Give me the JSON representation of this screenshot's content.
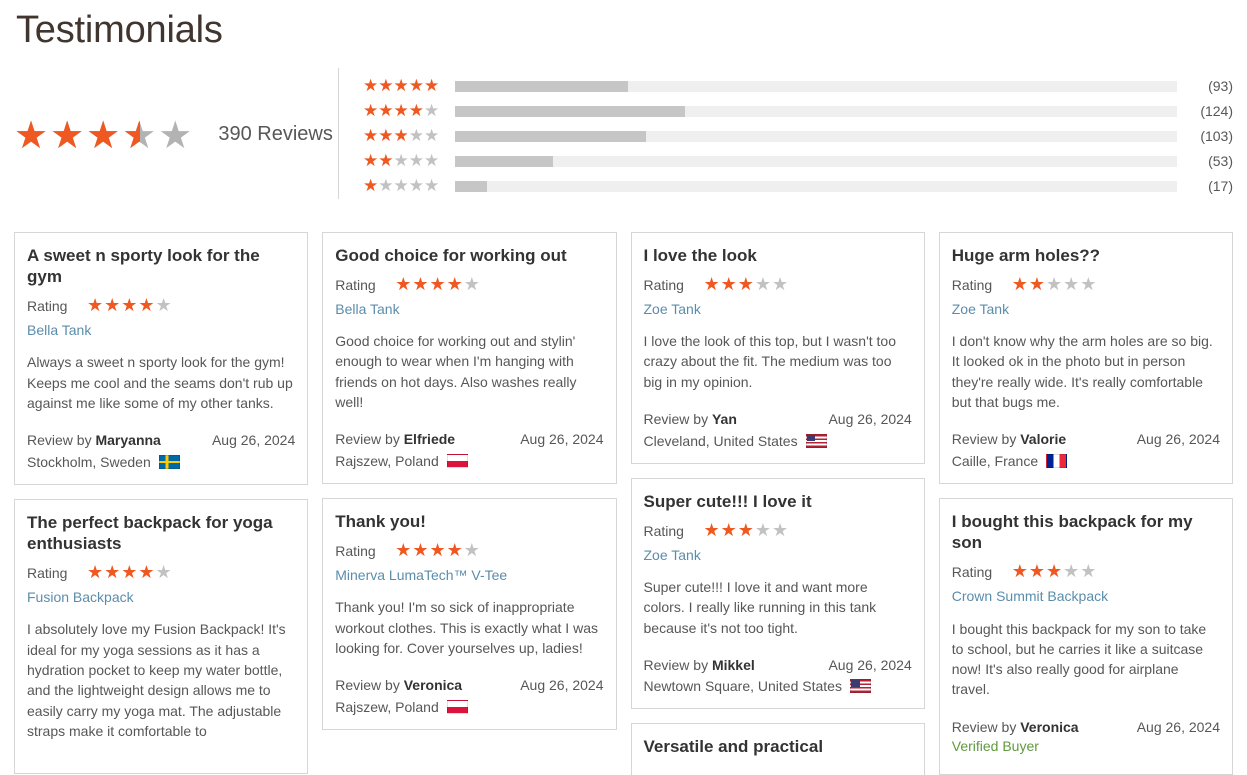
{
  "page": {
    "title": "Testimonials"
  },
  "summary": {
    "average_rating": 3.5,
    "average_stars_pct": 70,
    "reviews_count_label": "390 Reviews",
    "histogram": [
      {
        "stars": 5,
        "count_label": "(93)",
        "count": 93,
        "bar_pct": 24.0
      },
      {
        "stars": 4,
        "count_label": "(124)",
        "count": 124,
        "bar_pct": 31.8
      },
      {
        "stars": 3,
        "count_label": "(103)",
        "count": 103,
        "bar_pct": 26.5
      },
      {
        "stars": 2,
        "count_label": "(53)",
        "count": 53,
        "bar_pct": 13.6
      },
      {
        "stars": 1,
        "count_label": "(17)",
        "count": 17,
        "bar_pct": 4.4
      }
    ]
  },
  "labels": {
    "rating": "Rating",
    "review_by_prefix": "Review by",
    "verified_buyer": "Verified Buyer"
  },
  "colors": {
    "star_on": "#f05822",
    "star_off": "#c2c2c2",
    "link": "#5b8dab",
    "verified": "#5f9a3e",
    "bar_fill": "#c6c6c6",
    "bar_track": "#efefef"
  },
  "columns": [
    {
      "cards": [
        {
          "title": "A sweet n sporty look for the gym",
          "rating": 4,
          "product": "Bella Tank",
          "body": "Always a sweet n sporty look for the gym! Keeps me cool and the seams don't rub up against me like some of my other tanks.",
          "author": "Maryanna",
          "verified": false,
          "date": "Aug 26, 2024",
          "location": "Stockholm, Sweden",
          "flag": "flag-se",
          "flag_name": "sweden-flag-icon"
        },
        {
          "title": "The perfect backpack for yoga enthusiasts",
          "rating": 4,
          "product": "Fusion Backpack",
          "body": "I absolutely love my Fusion Backpack! It's ideal for my yoga sessions as it has a hydration pocket to keep my water bottle, and the lightweight design allows me to easily carry my yoga mat. The adjustable straps make it comfortable to",
          "author": "",
          "verified": false,
          "date": "",
          "location": "",
          "flag": "",
          "flag_name": "",
          "clipped": true
        }
      ]
    },
    {
      "cards": [
        {
          "title": "Good choice for working out",
          "rating": 4,
          "product": "Bella Tank",
          "body": "Good choice for working out and stylin' enough to wear when I'm hanging with friends on hot days. Also washes really well!",
          "author": "Elfriede",
          "verified": false,
          "date": "Aug 26, 2024",
          "location": "Rajszew, Poland",
          "flag": "flag-pl",
          "flag_name": "poland-flag-icon"
        },
        {
          "title": "Thank you!",
          "rating": 4,
          "product": "Minerva LumaTech™ V-Tee",
          "body": "Thank you! I'm so sick of inappropriate workout clothes. This is exactly what I was looking for. Cover yourselves up, ladies!",
          "author": "Veronica",
          "verified": false,
          "date": "Aug 26, 2024",
          "location": "Rajszew, Poland",
          "flag": "flag-pl",
          "flag_name": "poland-flag-icon"
        }
      ]
    },
    {
      "cards": [
        {
          "title": "I love the look",
          "rating": 3,
          "product": "Zoe Tank",
          "body": "I love the look of this top, but I wasn't too crazy about the fit. The medium was too big in my opinion.",
          "author": "Yan",
          "verified": false,
          "date": "Aug 26, 2024",
          "location": "Cleveland, United States",
          "flag": "flag-us",
          "flag_name": "united-states-flag-icon"
        },
        {
          "title": "Super cute!!! I love it",
          "rating": 3,
          "product": "Zoe Tank",
          "body": "Super cute!!! I love it and want more colors. I really like running in this tank because it's not too tight.",
          "author": "Mikkel",
          "verified": false,
          "date": "Aug 26, 2024",
          "location": "Newtown Square, United States",
          "flag": "flag-us",
          "flag_name": "united-states-flag-icon"
        },
        {
          "title": "Versatile and practical",
          "rating": 0,
          "product": "",
          "body": "",
          "author": "",
          "verified": false,
          "date": "",
          "location": "",
          "flag": "",
          "flag_name": "",
          "clipped": true
        }
      ]
    },
    {
      "cards": [
        {
          "title": "Huge arm holes??",
          "rating": 2,
          "product": "Zoe Tank",
          "body": "I don't know why the arm holes are so big. It looked ok in the photo but in person they're really wide. It's really comfortable but that bugs me.",
          "author": "Valorie",
          "verified": false,
          "date": "Aug 26, 2024",
          "location": "Caille, France",
          "flag": "flag-fr",
          "flag_name": "france-flag-icon"
        },
        {
          "title": "I bought this backpack for my son",
          "rating": 3,
          "product": "Crown Summit Backpack",
          "body": "I bought this backpack for my son to take to school, but he carries it like a suitcase now! It's also really good for airplane travel.",
          "author": "Veronica",
          "verified": true,
          "date": "Aug 26, 2024",
          "location": "",
          "flag": "",
          "flag_name": "",
          "clipped": true
        }
      ]
    }
  ]
}
